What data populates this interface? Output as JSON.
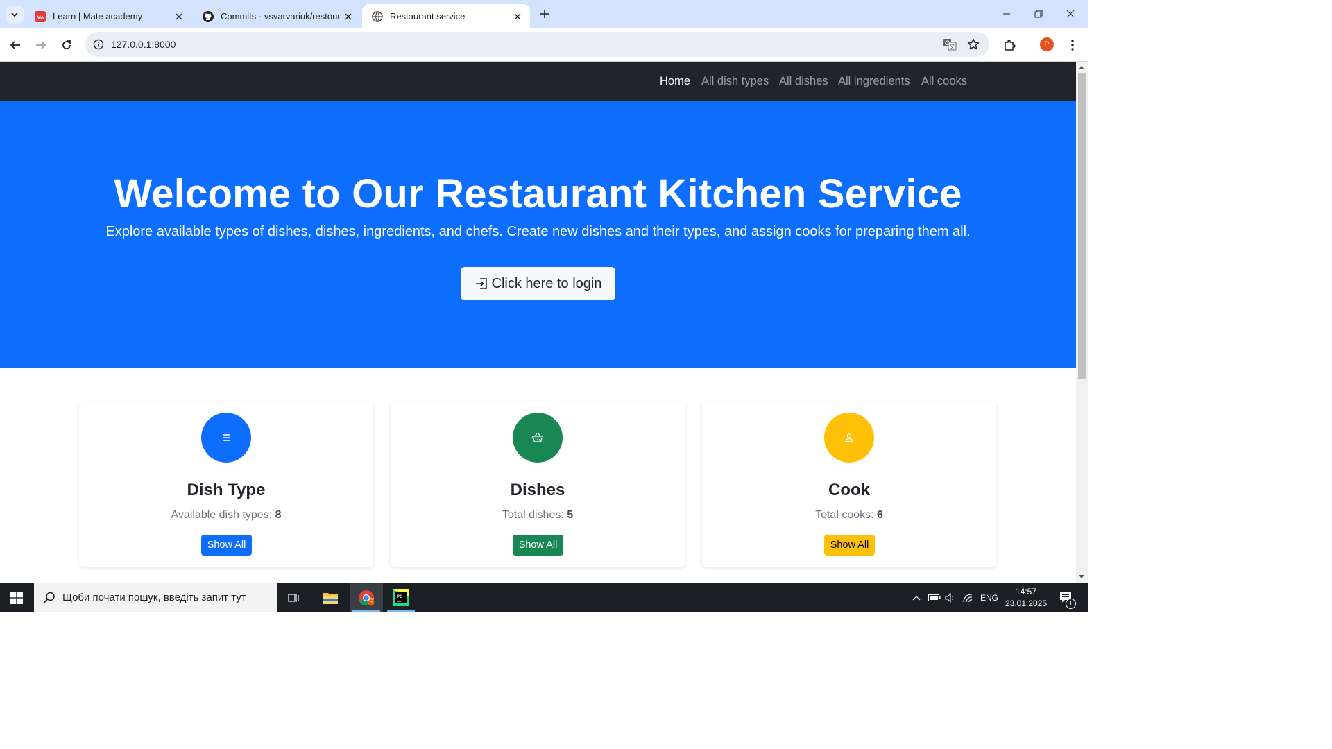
{
  "browser": {
    "tabs": [
      {
        "title": "Learn | Mate academy",
        "favicon": "mate-academy-icon"
      },
      {
        "title": "Commits · vsvarvariuk/restourant",
        "favicon": "github-icon"
      },
      {
        "title": "Restaurant service",
        "favicon": "globe-icon"
      }
    ],
    "url": "127.0.0.1:8000",
    "profile_initial": "P"
  },
  "navbar": {
    "links": [
      "Home",
      "All dish types",
      "All dishes",
      "All ingredients",
      "All cooks"
    ],
    "active": "Home"
  },
  "hero": {
    "title": "Welcome to Our Restaurant Kitchen Service",
    "subtitle": "Explore available types of dishes, dishes, ingredients, and chefs. Create new dishes and their types, and assign cooks for preparing them all.",
    "login_label": "Click here to login"
  },
  "cards": [
    {
      "title": "Dish Type",
      "stat_label": "Available dish types:",
      "stat_value": "8",
      "button": "Show All",
      "color": "#0d6efd",
      "icon": "list-icon"
    },
    {
      "title": "Dishes",
      "stat_label": "Total dishes:",
      "stat_value": "5",
      "button": "Show All",
      "color": "#198754",
      "icon": "basket-icon"
    },
    {
      "title": "Cook",
      "stat_label": "Total cooks:",
      "stat_value": "6",
      "button": "Show All",
      "color": "#ffc107",
      "icon": "person-icon"
    }
  ],
  "taskbar": {
    "search_placeholder": "Щоби почати пошук, введіть запит тут",
    "language": "ENG",
    "time": "14:57",
    "date": "23.01.2025",
    "notification_count": "1"
  }
}
